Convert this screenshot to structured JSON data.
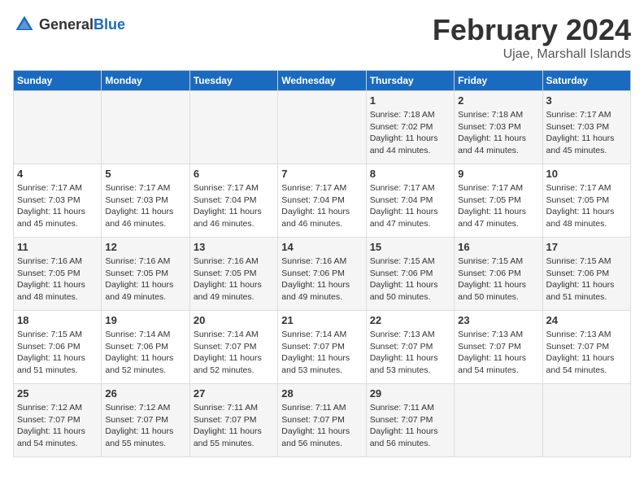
{
  "logo": {
    "general": "General",
    "blue": "Blue"
  },
  "title": "February 2024",
  "subtitle": "Ujae, Marshall Islands",
  "days_of_week": [
    "Sunday",
    "Monday",
    "Tuesday",
    "Wednesday",
    "Thursday",
    "Friday",
    "Saturday"
  ],
  "weeks": [
    [
      {
        "day": "",
        "sunrise": "",
        "sunset": "",
        "daylight": ""
      },
      {
        "day": "",
        "sunrise": "",
        "sunset": "",
        "daylight": ""
      },
      {
        "day": "",
        "sunrise": "",
        "sunset": "",
        "daylight": ""
      },
      {
        "day": "",
        "sunrise": "",
        "sunset": "",
        "daylight": ""
      },
      {
        "day": "1",
        "sunrise": "Sunrise: 7:18 AM",
        "sunset": "Sunset: 7:02 PM",
        "daylight": "Daylight: 11 hours and 44 minutes."
      },
      {
        "day": "2",
        "sunrise": "Sunrise: 7:18 AM",
        "sunset": "Sunset: 7:03 PM",
        "daylight": "Daylight: 11 hours and 44 minutes."
      },
      {
        "day": "3",
        "sunrise": "Sunrise: 7:17 AM",
        "sunset": "Sunset: 7:03 PM",
        "daylight": "Daylight: 11 hours and 45 minutes."
      }
    ],
    [
      {
        "day": "4",
        "sunrise": "Sunrise: 7:17 AM",
        "sunset": "Sunset: 7:03 PM",
        "daylight": "Daylight: 11 hours and 45 minutes."
      },
      {
        "day": "5",
        "sunrise": "Sunrise: 7:17 AM",
        "sunset": "Sunset: 7:03 PM",
        "daylight": "Daylight: 11 hours and 46 minutes."
      },
      {
        "day": "6",
        "sunrise": "Sunrise: 7:17 AM",
        "sunset": "Sunset: 7:04 PM",
        "daylight": "Daylight: 11 hours and 46 minutes."
      },
      {
        "day": "7",
        "sunrise": "Sunrise: 7:17 AM",
        "sunset": "Sunset: 7:04 PM",
        "daylight": "Daylight: 11 hours and 46 minutes."
      },
      {
        "day": "8",
        "sunrise": "Sunrise: 7:17 AM",
        "sunset": "Sunset: 7:04 PM",
        "daylight": "Daylight: 11 hours and 47 minutes."
      },
      {
        "day": "9",
        "sunrise": "Sunrise: 7:17 AM",
        "sunset": "Sunset: 7:05 PM",
        "daylight": "Daylight: 11 hours and 47 minutes."
      },
      {
        "day": "10",
        "sunrise": "Sunrise: 7:17 AM",
        "sunset": "Sunset: 7:05 PM",
        "daylight": "Daylight: 11 hours and 48 minutes."
      }
    ],
    [
      {
        "day": "11",
        "sunrise": "Sunrise: 7:16 AM",
        "sunset": "Sunset: 7:05 PM",
        "daylight": "Daylight: 11 hours and 48 minutes."
      },
      {
        "day": "12",
        "sunrise": "Sunrise: 7:16 AM",
        "sunset": "Sunset: 7:05 PM",
        "daylight": "Daylight: 11 hours and 49 minutes."
      },
      {
        "day": "13",
        "sunrise": "Sunrise: 7:16 AM",
        "sunset": "Sunset: 7:05 PM",
        "daylight": "Daylight: 11 hours and 49 minutes."
      },
      {
        "day": "14",
        "sunrise": "Sunrise: 7:16 AM",
        "sunset": "Sunset: 7:06 PM",
        "daylight": "Daylight: 11 hours and 49 minutes."
      },
      {
        "day": "15",
        "sunrise": "Sunrise: 7:15 AM",
        "sunset": "Sunset: 7:06 PM",
        "daylight": "Daylight: 11 hours and 50 minutes."
      },
      {
        "day": "16",
        "sunrise": "Sunrise: 7:15 AM",
        "sunset": "Sunset: 7:06 PM",
        "daylight": "Daylight: 11 hours and 50 minutes."
      },
      {
        "day": "17",
        "sunrise": "Sunrise: 7:15 AM",
        "sunset": "Sunset: 7:06 PM",
        "daylight": "Daylight: 11 hours and 51 minutes."
      }
    ],
    [
      {
        "day": "18",
        "sunrise": "Sunrise: 7:15 AM",
        "sunset": "Sunset: 7:06 PM",
        "daylight": "Daylight: 11 hours and 51 minutes."
      },
      {
        "day": "19",
        "sunrise": "Sunrise: 7:14 AM",
        "sunset": "Sunset: 7:06 PM",
        "daylight": "Daylight: 11 hours and 52 minutes."
      },
      {
        "day": "20",
        "sunrise": "Sunrise: 7:14 AM",
        "sunset": "Sunset: 7:07 PM",
        "daylight": "Daylight: 11 hours and 52 minutes."
      },
      {
        "day": "21",
        "sunrise": "Sunrise: 7:14 AM",
        "sunset": "Sunset: 7:07 PM",
        "daylight": "Daylight: 11 hours and 53 minutes."
      },
      {
        "day": "22",
        "sunrise": "Sunrise: 7:13 AM",
        "sunset": "Sunset: 7:07 PM",
        "daylight": "Daylight: 11 hours and 53 minutes."
      },
      {
        "day": "23",
        "sunrise": "Sunrise: 7:13 AM",
        "sunset": "Sunset: 7:07 PM",
        "daylight": "Daylight: 11 hours and 54 minutes."
      },
      {
        "day": "24",
        "sunrise": "Sunrise: 7:13 AM",
        "sunset": "Sunset: 7:07 PM",
        "daylight": "Daylight: 11 hours and 54 minutes."
      }
    ],
    [
      {
        "day": "25",
        "sunrise": "Sunrise: 7:12 AM",
        "sunset": "Sunset: 7:07 PM",
        "daylight": "Daylight: 11 hours and 54 minutes."
      },
      {
        "day": "26",
        "sunrise": "Sunrise: 7:12 AM",
        "sunset": "Sunset: 7:07 PM",
        "daylight": "Daylight: 11 hours and 55 minutes."
      },
      {
        "day": "27",
        "sunrise": "Sunrise: 7:11 AM",
        "sunset": "Sunset: 7:07 PM",
        "daylight": "Daylight: 11 hours and 55 minutes."
      },
      {
        "day": "28",
        "sunrise": "Sunrise: 7:11 AM",
        "sunset": "Sunset: 7:07 PM",
        "daylight": "Daylight: 11 hours and 56 minutes."
      },
      {
        "day": "29",
        "sunrise": "Sunrise: 7:11 AM",
        "sunset": "Sunset: 7:07 PM",
        "daylight": "Daylight: 11 hours and 56 minutes."
      },
      {
        "day": "",
        "sunrise": "",
        "sunset": "",
        "daylight": ""
      },
      {
        "day": "",
        "sunrise": "",
        "sunset": "",
        "daylight": ""
      }
    ]
  ]
}
